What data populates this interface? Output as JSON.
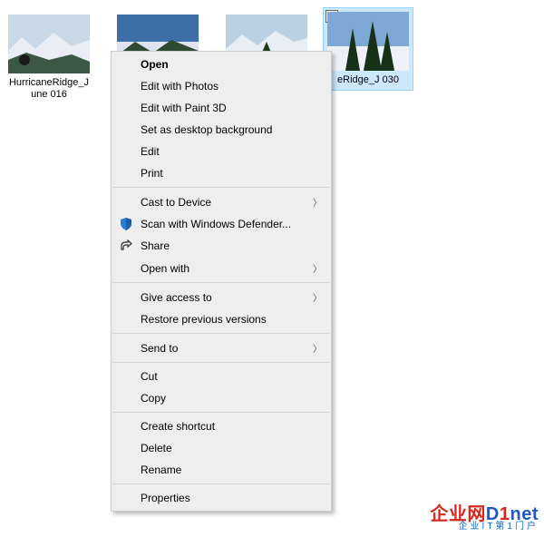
{
  "files": [
    {
      "label": "HurricaneRidge_June 016"
    },
    {
      "label": ""
    },
    {
      "label": ""
    },
    {
      "label": "eRidge_J 030",
      "selected": true
    }
  ],
  "menu": {
    "open": "Open",
    "edit_photos": "Edit with Photos",
    "edit_paint3d": "Edit with Paint 3D",
    "set_bg": "Set as desktop background",
    "edit": "Edit",
    "print": "Print",
    "cast": "Cast to Device",
    "defender": "Scan with Windows Defender...",
    "share": "Share",
    "open_with": "Open with",
    "give_access": "Give access to",
    "restore": "Restore previous versions",
    "send_to": "Send to",
    "cut": "Cut",
    "copy": "Copy",
    "shortcut": "Create shortcut",
    "delete": "Delete",
    "rename": "Rename",
    "properties": "Properties"
  },
  "watermark": {
    "line1_a": "企业网",
    "line1_b": "D",
    "line1_c": "1",
    "line1_d": "net",
    "line2": "企业IT第1门户"
  }
}
